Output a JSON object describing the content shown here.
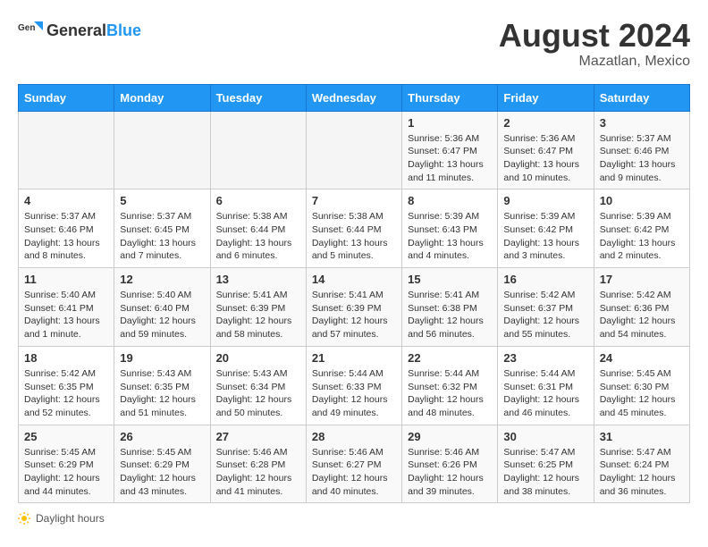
{
  "header": {
    "logo_general": "General",
    "logo_blue": "Blue",
    "title": "August 2024",
    "subtitle": "Mazatlan, Mexico"
  },
  "calendar": {
    "days_of_week": [
      "Sunday",
      "Monday",
      "Tuesday",
      "Wednesday",
      "Thursday",
      "Friday",
      "Saturday"
    ],
    "weeks": [
      {
        "days": [
          {
            "number": "",
            "info": ""
          },
          {
            "number": "",
            "info": ""
          },
          {
            "number": "",
            "info": ""
          },
          {
            "number": "",
            "info": ""
          },
          {
            "number": "1",
            "info": "Sunrise: 5:36 AM\nSunset: 6:47 PM\nDaylight: 13 hours and 11 minutes."
          },
          {
            "number": "2",
            "info": "Sunrise: 5:36 AM\nSunset: 6:47 PM\nDaylight: 13 hours and 10 minutes."
          },
          {
            "number": "3",
            "info": "Sunrise: 5:37 AM\nSunset: 6:46 PM\nDaylight: 13 hours and 9 minutes."
          }
        ]
      },
      {
        "days": [
          {
            "number": "4",
            "info": "Sunrise: 5:37 AM\nSunset: 6:46 PM\nDaylight: 13 hours and 8 minutes."
          },
          {
            "number": "5",
            "info": "Sunrise: 5:37 AM\nSunset: 6:45 PM\nDaylight: 13 hours and 7 minutes."
          },
          {
            "number": "6",
            "info": "Sunrise: 5:38 AM\nSunset: 6:44 PM\nDaylight: 13 hours and 6 minutes."
          },
          {
            "number": "7",
            "info": "Sunrise: 5:38 AM\nSunset: 6:44 PM\nDaylight: 13 hours and 5 minutes."
          },
          {
            "number": "8",
            "info": "Sunrise: 5:39 AM\nSunset: 6:43 PM\nDaylight: 13 hours and 4 minutes."
          },
          {
            "number": "9",
            "info": "Sunrise: 5:39 AM\nSunset: 6:42 PM\nDaylight: 13 hours and 3 minutes."
          },
          {
            "number": "10",
            "info": "Sunrise: 5:39 AM\nSunset: 6:42 PM\nDaylight: 13 hours and 2 minutes."
          }
        ]
      },
      {
        "days": [
          {
            "number": "11",
            "info": "Sunrise: 5:40 AM\nSunset: 6:41 PM\nDaylight: 13 hours and 1 minute."
          },
          {
            "number": "12",
            "info": "Sunrise: 5:40 AM\nSunset: 6:40 PM\nDaylight: 12 hours and 59 minutes."
          },
          {
            "number": "13",
            "info": "Sunrise: 5:41 AM\nSunset: 6:39 PM\nDaylight: 12 hours and 58 minutes."
          },
          {
            "number": "14",
            "info": "Sunrise: 5:41 AM\nSunset: 6:39 PM\nDaylight: 12 hours and 57 minutes."
          },
          {
            "number": "15",
            "info": "Sunrise: 5:41 AM\nSunset: 6:38 PM\nDaylight: 12 hours and 56 minutes."
          },
          {
            "number": "16",
            "info": "Sunrise: 5:42 AM\nSunset: 6:37 PM\nDaylight: 12 hours and 55 minutes."
          },
          {
            "number": "17",
            "info": "Sunrise: 5:42 AM\nSunset: 6:36 PM\nDaylight: 12 hours and 54 minutes."
          }
        ]
      },
      {
        "days": [
          {
            "number": "18",
            "info": "Sunrise: 5:42 AM\nSunset: 6:35 PM\nDaylight: 12 hours and 52 minutes."
          },
          {
            "number": "19",
            "info": "Sunrise: 5:43 AM\nSunset: 6:35 PM\nDaylight: 12 hours and 51 minutes."
          },
          {
            "number": "20",
            "info": "Sunrise: 5:43 AM\nSunset: 6:34 PM\nDaylight: 12 hours and 50 minutes."
          },
          {
            "number": "21",
            "info": "Sunrise: 5:44 AM\nSunset: 6:33 PM\nDaylight: 12 hours and 49 minutes."
          },
          {
            "number": "22",
            "info": "Sunrise: 5:44 AM\nSunset: 6:32 PM\nDaylight: 12 hours and 48 minutes."
          },
          {
            "number": "23",
            "info": "Sunrise: 5:44 AM\nSunset: 6:31 PM\nDaylight: 12 hours and 46 minutes."
          },
          {
            "number": "24",
            "info": "Sunrise: 5:45 AM\nSunset: 6:30 PM\nDaylight: 12 hours and 45 minutes."
          }
        ]
      },
      {
        "days": [
          {
            "number": "25",
            "info": "Sunrise: 5:45 AM\nSunset: 6:29 PM\nDaylight: 12 hours and 44 minutes."
          },
          {
            "number": "26",
            "info": "Sunrise: 5:45 AM\nSunset: 6:29 PM\nDaylight: 12 hours and 43 minutes."
          },
          {
            "number": "27",
            "info": "Sunrise: 5:46 AM\nSunset: 6:28 PM\nDaylight: 12 hours and 41 minutes."
          },
          {
            "number": "28",
            "info": "Sunrise: 5:46 AM\nSunset: 6:27 PM\nDaylight: 12 hours and 40 minutes."
          },
          {
            "number": "29",
            "info": "Sunrise: 5:46 AM\nSunset: 6:26 PM\nDaylight: 12 hours and 39 minutes."
          },
          {
            "number": "30",
            "info": "Sunrise: 5:47 AM\nSunset: 6:25 PM\nDaylight: 12 hours and 38 minutes."
          },
          {
            "number": "31",
            "info": "Sunrise: 5:47 AM\nSunset: 6:24 PM\nDaylight: 12 hours and 36 minutes."
          }
        ]
      }
    ]
  },
  "footer": {
    "daylight_hours_label": "Daylight hours"
  }
}
